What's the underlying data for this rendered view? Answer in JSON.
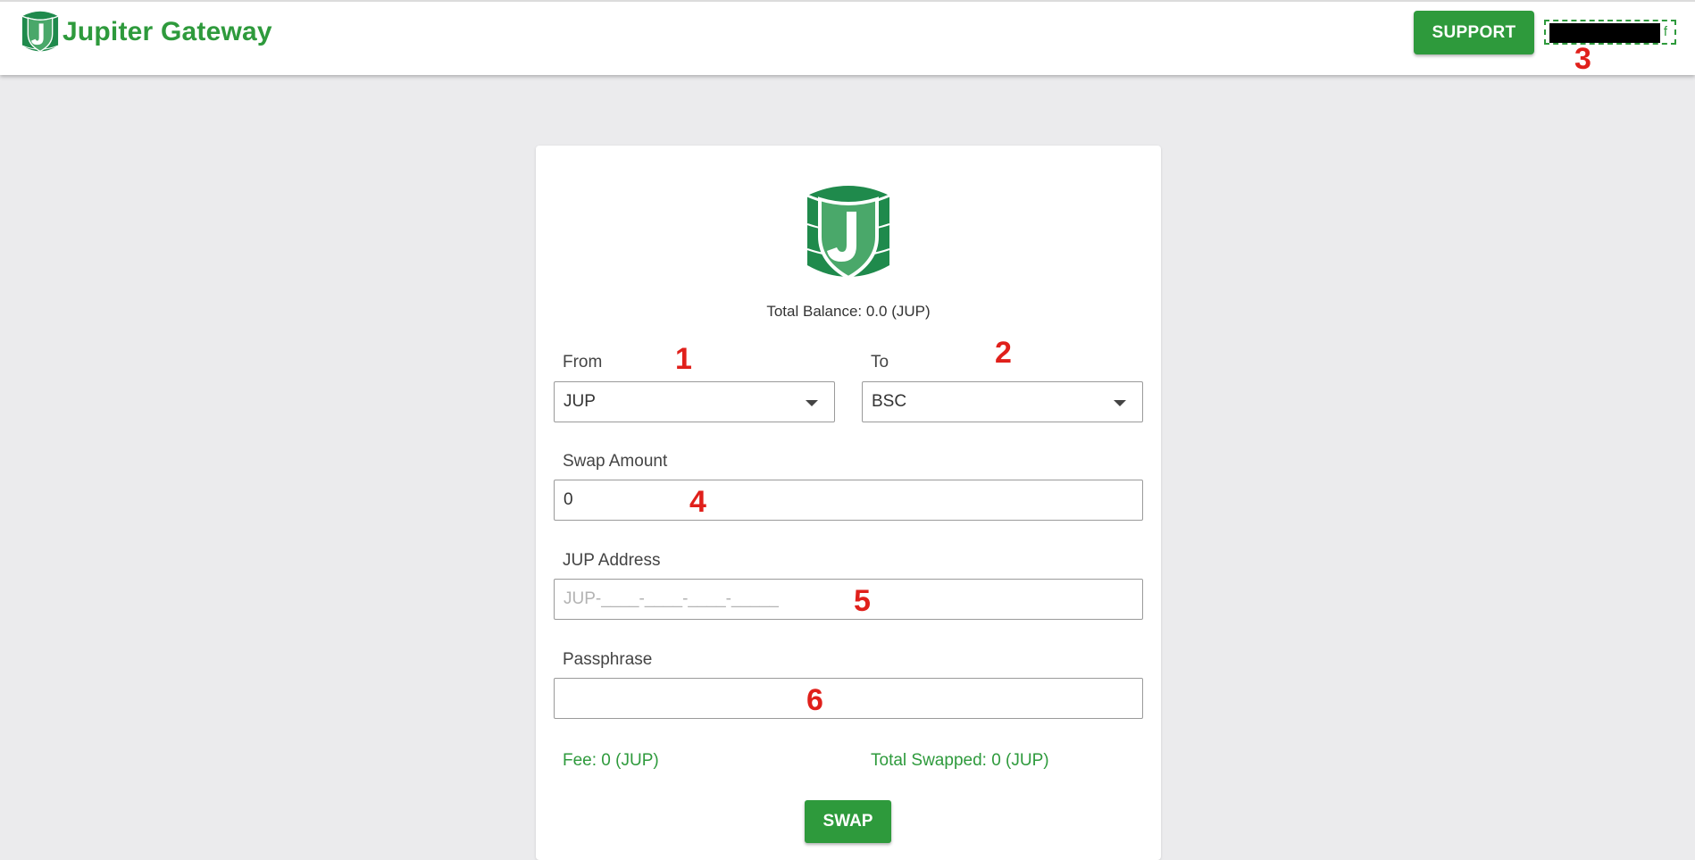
{
  "header": {
    "brand_name": "Jupiter Gateway",
    "support_label": "SUPPORT",
    "account_suffix": "f"
  },
  "markers": [
    "1",
    "2",
    "3",
    "4",
    "5",
    "6"
  ],
  "card": {
    "balance_text": "Total Balance: 0.0 (JUP)",
    "from_label": "From",
    "from_value": "JUP",
    "to_label": "To",
    "to_value": "BSC",
    "swap_amount_label": "Swap Amount",
    "swap_amount_value": "0",
    "address_label": "JUP Address",
    "address_placeholder": "JUP-____-____-____-_____",
    "passphrase_label": "Passphrase",
    "passphrase_value": "",
    "fee_text": "Fee: 0 (JUP)",
    "total_swapped_text": "Total Swapped: 0 (JUP)",
    "swap_label": "SWAP"
  },
  "colors": {
    "brand_green": "#2e9a3c",
    "logo_green": "#1f8a4c",
    "marker_red": "#e0201b",
    "page_bg": "#ebebed"
  },
  "icons": {
    "brand_logo": "jupiter-logo-icon",
    "card_logo": "jupiter-logo-icon",
    "select_caret": "caret-down-icon"
  }
}
